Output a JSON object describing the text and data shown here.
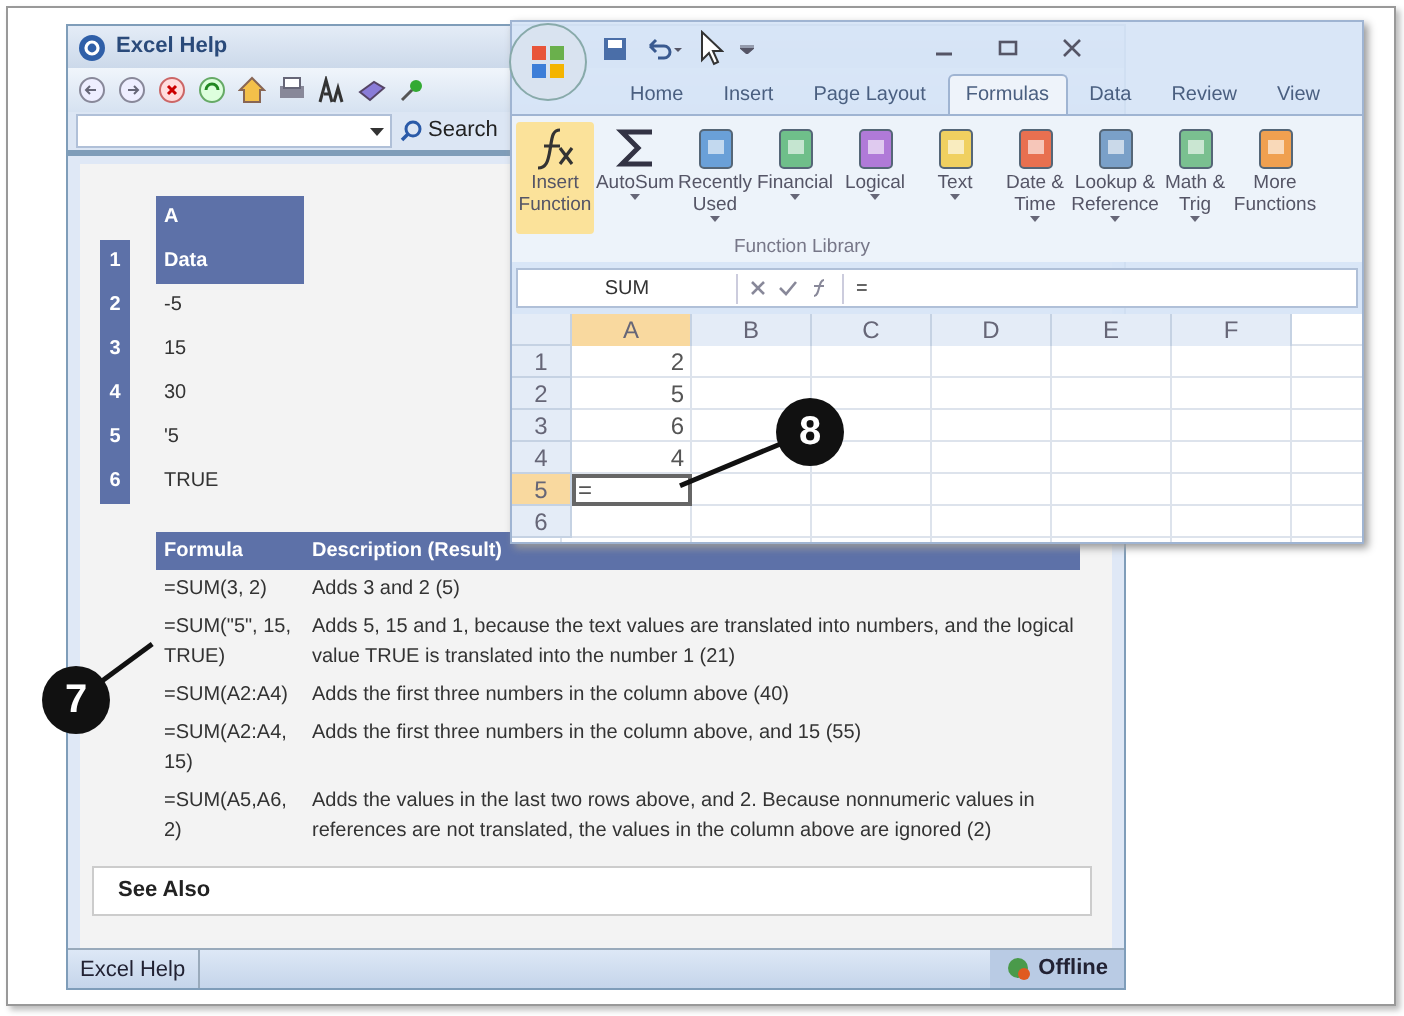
{
  "help_window": {
    "title": "Excel Help",
    "search": {
      "button": "Search"
    },
    "example": {
      "column_header": "A",
      "rows": [
        {
          "number": "1",
          "value": "Data",
          "header": true
        },
        {
          "number": "2",
          "value": "-5",
          "header": false
        },
        {
          "number": "3",
          "value": "15",
          "header": false
        },
        {
          "number": "4",
          "value": "30",
          "header": false
        },
        {
          "number": "5",
          "value": "'5",
          "header": false
        },
        {
          "number": "6",
          "value": "TRUE",
          "header": false
        }
      ]
    },
    "formulas": {
      "columns": [
        "Formula",
        "Description (Result)"
      ],
      "rows": [
        [
          "=SUM(3, 2)",
          "Adds 3 and 2 (5)"
        ],
        [
          "=SUM(\"5\", 15, TRUE)",
          "Adds 5, 15 and 1, because the text values are translated into numbers, and the logical value TRUE is translated into the number 1 (21)"
        ],
        [
          "=SUM(A2:A4)",
          "Adds the first three numbers in the column above (40)"
        ],
        [
          "=SUM(A2:A4, 15)",
          "Adds the first three numbers in the column above, and 15 (55)"
        ],
        [
          "=SUM(A5,A6, 2)",
          "Adds the values in the last two rows above, and 2. Because nonnumeric values in references are not translated, the values in the column above are ignored (2)"
        ]
      ]
    },
    "see_also": "See Also",
    "status_bar": {
      "left": "Excel Help",
      "right": "Offline"
    }
  },
  "excel_window": {
    "tabs": [
      {
        "label": "Home",
        "selected": false
      },
      {
        "label": "Insert",
        "selected": false
      },
      {
        "label": "Page Layout",
        "selected": false
      },
      {
        "label": "Formulas",
        "selected": true
      },
      {
        "label": "Data",
        "selected": false
      },
      {
        "label": "Review",
        "selected": false
      },
      {
        "label": "View",
        "selected": false
      }
    ],
    "ribbon": {
      "group": "Function Library",
      "buttons": [
        {
          "kind": "fx",
          "label": "Insert Function",
          "dropdown": false,
          "selected": true
        },
        {
          "kind": "sigma",
          "label": "AutoSum",
          "dropdown": true,
          "selected": false
        },
        {
          "kind": "book",
          "label": "Recently Used",
          "dropdown": true,
          "selected": false
        },
        {
          "kind": "book",
          "label": "Financial",
          "dropdown": true,
          "selected": false
        },
        {
          "kind": "book",
          "label": "Logical",
          "dropdown": true,
          "selected": false
        },
        {
          "kind": "book",
          "label": "Text",
          "dropdown": true,
          "selected": false
        },
        {
          "kind": "book",
          "label": "Date & Time",
          "dropdown": true,
          "selected": false
        },
        {
          "kind": "book",
          "label": "Lookup & Reference",
          "dropdown": true,
          "selected": false
        },
        {
          "kind": "book",
          "label": "Math & Trig",
          "dropdown": true,
          "selected": false
        },
        {
          "kind": "book",
          "label": "More Functions",
          "dropdown": false,
          "selected": false
        }
      ]
    },
    "name_box": "SUM",
    "formula": "=",
    "columns": [
      {
        "label": "A",
        "selected": true
      },
      {
        "label": "B",
        "selected": false
      },
      {
        "label": "C",
        "selected": false
      },
      {
        "label": "D",
        "selected": false
      },
      {
        "label": "E",
        "selected": false
      },
      {
        "label": "F",
        "selected": false
      }
    ],
    "rows": [
      {
        "number": "1",
        "value": "2",
        "selected": false
      },
      {
        "number": "2",
        "value": "5",
        "selected": false
      },
      {
        "number": "3",
        "value": "6",
        "selected": false
      },
      {
        "number": "4",
        "value": "4",
        "selected": false
      },
      {
        "number": "5",
        "value": "=",
        "selected": true
      },
      {
        "number": "6",
        "value": "",
        "selected": false
      }
    ]
  },
  "callouts": [
    "7",
    "8"
  ]
}
